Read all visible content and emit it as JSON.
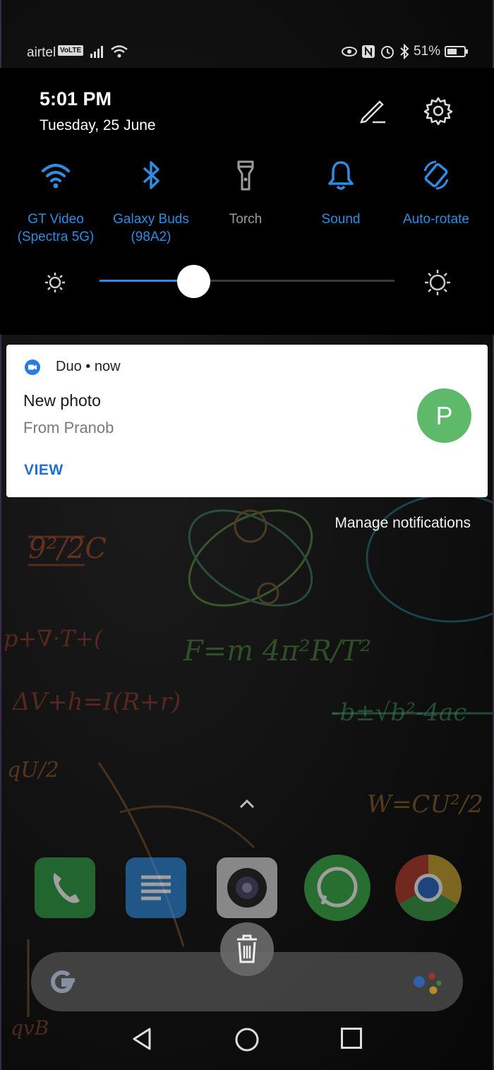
{
  "status_bar": {
    "carrier": "airtel",
    "volte_badge": "VoLTE",
    "battery_percent": "51%",
    "icons": [
      "signal-icon",
      "wifi-icon",
      "eye-comfort-icon",
      "nfc-icon",
      "alarm-icon",
      "bluetooth-icon",
      "battery-icon"
    ]
  },
  "quick_settings": {
    "time": "5:01 PM",
    "date": "Tuesday, 25 June",
    "tiles": [
      {
        "label_line1": "GT Video",
        "label_line2": "(Spectra 5G)",
        "icon": "wifi-icon",
        "active": true
      },
      {
        "label_line1": "Galaxy Buds",
        "label_line2": "(98A2)",
        "icon": "bluetooth-icon",
        "active": true
      },
      {
        "label_line1": "Torch",
        "label_line2": "",
        "icon": "torch-icon",
        "active": false
      },
      {
        "label_line1": "Sound",
        "label_line2": "",
        "icon": "bell-icon",
        "active": true
      },
      {
        "label_line1": "Auto-rotate",
        "label_line2": "",
        "icon": "auto-rotate-icon",
        "active": true
      }
    ],
    "brightness_level": 0.32
  },
  "notification": {
    "app_name": "Duo",
    "separator": "•",
    "time": "now",
    "title": "New photo",
    "text": "From Pranob",
    "avatar_letter": "P",
    "action": "VIEW"
  },
  "manage_notifications": "Manage notifications",
  "dock": {
    "apps": [
      "phone-app-icon",
      "docs-app-icon",
      "camera-app-icon",
      "whatsapp-app-icon",
      "chrome-app-icon"
    ]
  },
  "colors": {
    "accent": "#2e8de0",
    "panel_bg": "#000000",
    "avatar": "#5fb96a",
    "duo_blue": "#2a7be2"
  }
}
